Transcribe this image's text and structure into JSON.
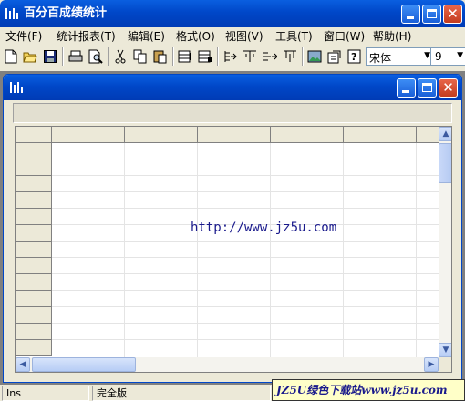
{
  "app": {
    "title": "百分百成绩统计"
  },
  "menu": [
    "文件(F)",
    "统计报表(T)",
    "编辑(E)",
    "格式(O)",
    "视图(V)",
    "工具(T)",
    "窗口(W)",
    "帮助(H)"
  ],
  "toolbar": {
    "icons": [
      "new-icon",
      "open-icon",
      "save-icon",
      "print-icon",
      "print-preview-icon",
      "cut-icon",
      "copy-icon",
      "paste-icon",
      "insert-row-icon",
      "delete-row-icon",
      "insert-column-left-icon",
      "insert-column-icon",
      "insert-column-right-icon",
      "filter-column-icon",
      "image-icon",
      "properties-icon",
      "help-icon"
    ],
    "font_name": "宋体",
    "font_size": "9"
  },
  "child_window": {
    "title": ""
  },
  "sheet": {
    "watermark": "http://www.jz5u.com"
  },
  "status": {
    "mode": "Ins",
    "edition": "完全版"
  },
  "banner": {
    "text": "JZ5U绿色下载站www.jz5u.com"
  },
  "colors": {
    "titlebar": "#0047c8",
    "banner_bg": "#ffffc8",
    "link": "#1a1a8c"
  }
}
